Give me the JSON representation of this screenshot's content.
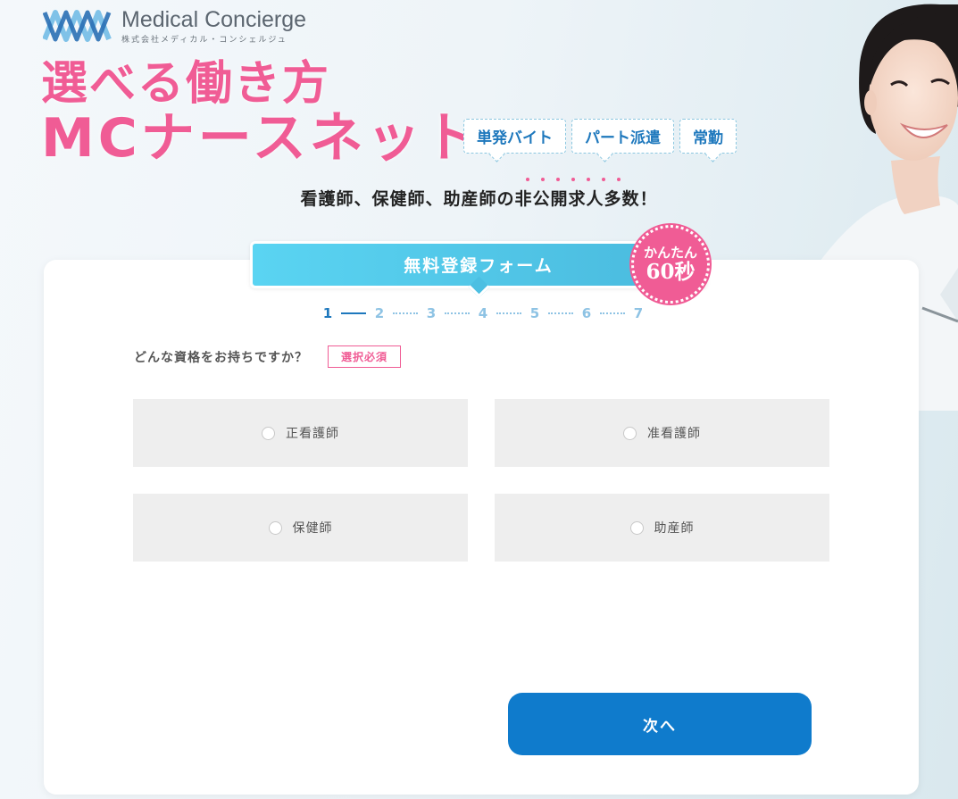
{
  "header": {
    "logo_name": "Medical Concierge",
    "logo_sub": "株式会社メディカル・コンシェルジュ",
    "catch_line1": "選べる働き方",
    "catch_line2": "MCナースネット",
    "tags": [
      "単発バイト",
      "パート派遣",
      "常勤"
    ],
    "tagline": "看護師、保健師、助産師の非公開求人多数！"
  },
  "form": {
    "title": "無料登録フォーム",
    "badge_small": "かんたん",
    "badge_big": "60秒",
    "steps": [
      "1",
      "2",
      "3",
      "4",
      "5",
      "6",
      "7"
    ],
    "current_step": 1,
    "question": "どんな資格をお持ちですか？",
    "required_label": "選択必須",
    "options": [
      "正看護師",
      "准看護師",
      "保健師",
      "助産師"
    ],
    "next_label": "次へ"
  },
  "colors": {
    "brand_pink": "#f05c95",
    "brand_blue": "#1e78bd",
    "button_blue": "#0f7bcc",
    "title_cyan": "#5ad4f2"
  }
}
